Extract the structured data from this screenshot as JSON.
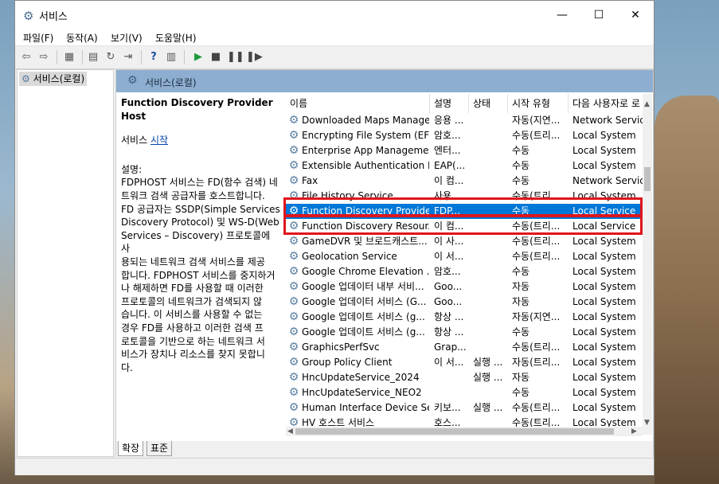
{
  "window": {
    "title": "서비스",
    "minimize": "—",
    "maximize": "☐",
    "close": "✕"
  },
  "menu": [
    "파일(F)",
    "동작(A)",
    "보기(V)",
    "도움말(H)"
  ],
  "tree": {
    "item": "서비스(로컬)"
  },
  "panel": {
    "header": "서비스(로컬)"
  },
  "description": {
    "title": "Function Discovery Provider Host",
    "action_prefix": "서비스 ",
    "action_link": "시작",
    "label": "설명:",
    "body": "FDPHOST 서비스는 FD(함수 검색) 네\n트워크 검색 공급자를 호스트합니다.\nFD 공급자는 SSDP(Simple Services\nDiscovery Protocol) 및 WS-D(Web\nServices – Discovery) 프로토콜에 사\n용되는 네트워크 검색 서비스를 제공\n합니다. FDPHOST 서비스를 중지하거\n나 해제하면 FD를 사용할 때 이러한\n프로토콜의 네트워크가 검색되지 않\n습니다. 이 서비스를 사용할 수 없는\n경우 FD를 사용하고 이러한 검색 프\n로토콜을 기반으로 하는 네트워크 서\n비스가 장치나 리소스를 찾지 못합니\n다."
  },
  "columns": {
    "name": "이름",
    "description": "설명",
    "status": "상태",
    "startup": "시작 유형",
    "logon": "다음 사용자로 로"
  },
  "services": [
    {
      "name": "Downloaded Maps Manager",
      "desc": "응용 ...",
      "status": "",
      "startup": "자동(지연...",
      "logon": "Network Service"
    },
    {
      "name": "Encrypting File System (EFS)",
      "desc": "암호...",
      "status": "",
      "startup": "수동(트리...",
      "logon": "Local System"
    },
    {
      "name": "Enterprise App Manageme...",
      "desc": "엔터...",
      "status": "",
      "startup": "수동",
      "logon": "Local System"
    },
    {
      "name": "Extensible Authentication P...",
      "desc": "EAP(...",
      "status": "",
      "startup": "수동",
      "logon": "Local System"
    },
    {
      "name": "Fax",
      "desc": "이 컴...",
      "status": "",
      "startup": "수동",
      "logon": "Network Service"
    },
    {
      "name": "File History Service",
      "desc": "사용...",
      "status": "",
      "startup": "수동(트리...",
      "logon": "Local System"
    },
    {
      "name": "Function Discovery Provide...",
      "desc": "FDP...",
      "status": "",
      "startup": "수동",
      "logon": "Local Service"
    },
    {
      "name": "Function Discovery Resour...",
      "desc": "이 컴...",
      "status": "",
      "startup": "수동(트리...",
      "logon": "Local Service"
    },
    {
      "name": "GameDVR 및 브로드캐스트...",
      "desc": "이 사...",
      "status": "",
      "startup": "수동(트리...",
      "logon": "Local System"
    },
    {
      "name": "Geolocation Service",
      "desc": "이 서...",
      "status": "",
      "startup": "수동(트리...",
      "logon": "Local System"
    },
    {
      "name": "Google Chrome Elevation ...",
      "desc": "암호...",
      "status": "",
      "startup": "수동",
      "logon": "Local System"
    },
    {
      "name": "Google 업데이터 내부 서비...",
      "desc": "Goo...",
      "status": "",
      "startup": "자동",
      "logon": "Local System"
    },
    {
      "name": "Google 업데이터 서비스 (G...",
      "desc": "Goo...",
      "status": "",
      "startup": "자동",
      "logon": "Local System"
    },
    {
      "name": "Google 업데이트 서비스 (g...",
      "desc": "항상 ...",
      "status": "",
      "startup": "자동(지연...",
      "logon": "Local System"
    },
    {
      "name": "Google 업데이트 서비스 (g...",
      "desc": "항상 ...",
      "status": "",
      "startup": "수동",
      "logon": "Local System"
    },
    {
      "name": "GraphicsPerfSvc",
      "desc": "Grap...",
      "status": "",
      "startup": "수동(트리...",
      "logon": "Local System"
    },
    {
      "name": "Group Policy Client",
      "desc": "이 서...",
      "status": "실행 ...",
      "startup": "자동(트리...",
      "logon": "Local System"
    },
    {
      "name": "HncUpdateService_2024",
      "desc": "",
      "status": "실행 ...",
      "startup": "자동",
      "logon": "Local System"
    },
    {
      "name": "HncUpdateService_NEO2",
      "desc": "",
      "status": "",
      "startup": "수동",
      "logon": "Local System"
    },
    {
      "name": "Human Interface Device Se...",
      "desc": "키보...",
      "status": "실행 ...",
      "startup": "수동(트리...",
      "logon": "Local System"
    },
    {
      "name": "HV 호스트 서비스",
      "desc": "호스...",
      "status": "",
      "startup": "수동(트리...",
      "logon": "Local System"
    }
  ],
  "selected_index": 6,
  "highlight_color": "#e0141c",
  "tabs": [
    "확장",
    "표준"
  ],
  "icons": [
    "gear-icon",
    "back-icon",
    "forward-icon",
    "play-icon",
    "stop-icon",
    "pause-icon",
    "resume-icon",
    "help-icon"
  ]
}
